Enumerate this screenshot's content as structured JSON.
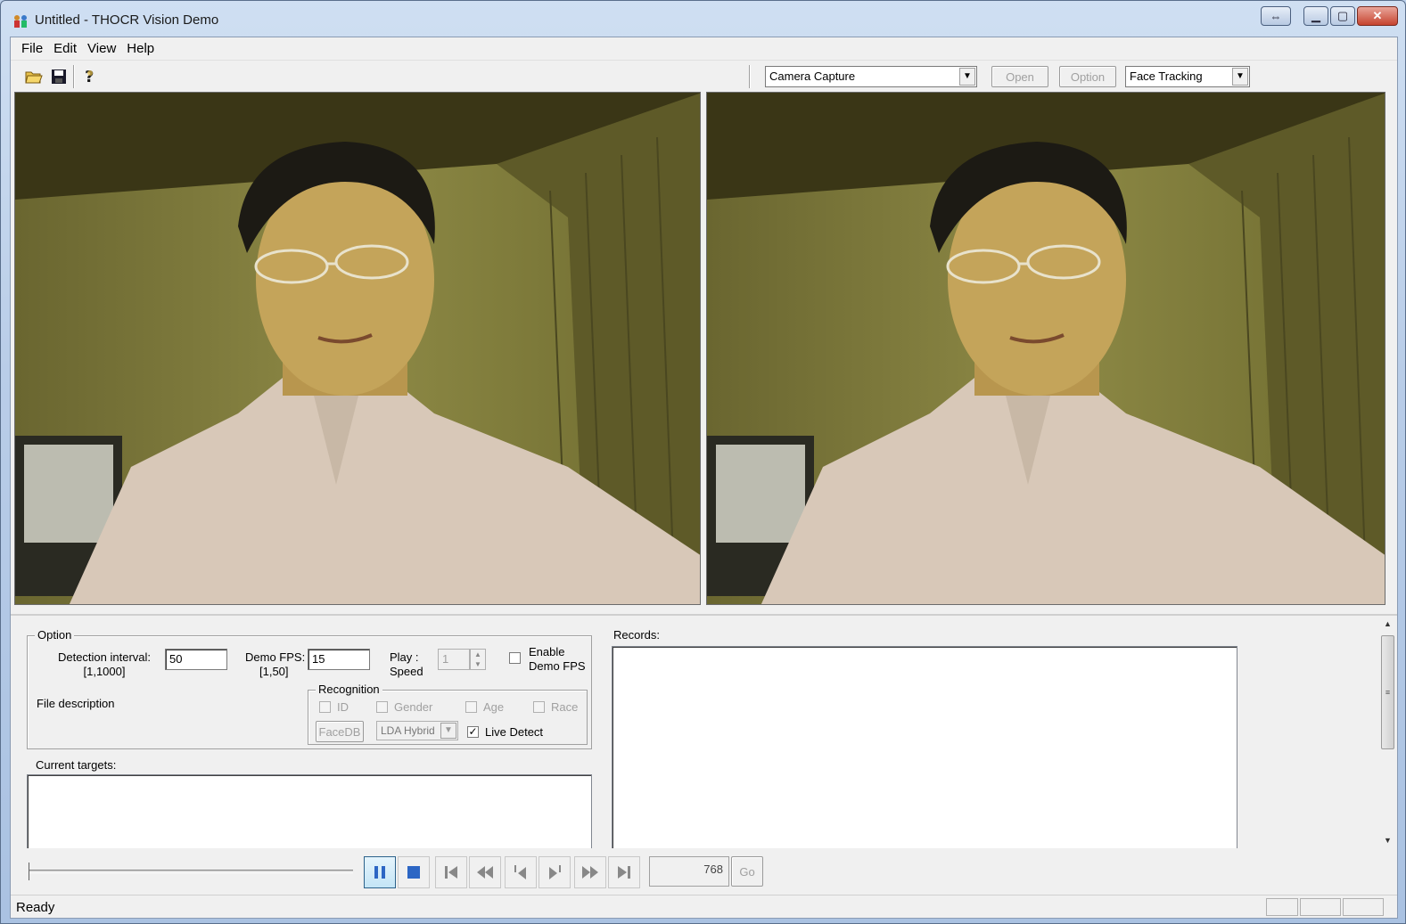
{
  "window": {
    "title": "Untitled - THOCR Vision Demo"
  },
  "menu": {
    "items": [
      "File",
      "Edit",
      "View",
      "Help"
    ]
  },
  "toolbar": {
    "source_combo": "Camera Capture",
    "open_label": "Open",
    "option_label": "Option",
    "mode_combo": "Face Tracking"
  },
  "option_group": {
    "title": "Option",
    "detection_interval_label": "Detection interval:",
    "detection_interval_range": "[1,1000]",
    "detection_interval_value": "50",
    "demo_fps_label": "Demo FPS:",
    "demo_fps_range": "[1,50]",
    "demo_fps_value": "15",
    "play_label": "Play :",
    "speed_label": "Speed",
    "play_speed_value": "1",
    "enable_label": "Enable",
    "demo_fps_check_label": "Demo FPS",
    "file_description_label": "File description"
  },
  "recognition": {
    "title": "Recognition",
    "id_label": "ID",
    "gender_label": "Gender",
    "age_label": "Age",
    "race_label": "Race",
    "facedb_label": "FaceDB",
    "algorithm_value": "LDA Hybrid",
    "live_detect_label": "Live Detect",
    "live_detect_checked": true
  },
  "current_targets_label": "Current targets:",
  "records_label": "Records:",
  "playback": {
    "frame_value": "768",
    "go_label": "Go"
  },
  "status": {
    "text": "Ready"
  }
}
